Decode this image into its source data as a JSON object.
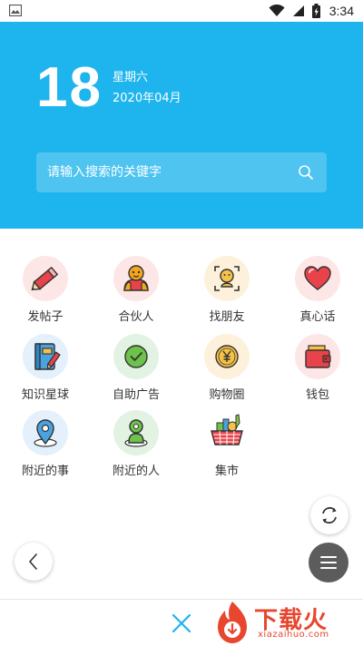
{
  "status_bar": {
    "time": "3:34",
    "icons": [
      "image-icon",
      "wifi-icon",
      "signal-icon",
      "battery-icon"
    ]
  },
  "header": {
    "day": "18",
    "weekday": "星期六",
    "year_month": "2020年04月",
    "background": "#1eb4ee"
  },
  "search": {
    "placeholder": "请输入搜索的关键字",
    "icon": "search-icon"
  },
  "features": [
    {
      "label": "发帖子",
      "icon": "pencil-icon"
    },
    {
      "label": "合伙人",
      "icon": "partner-icon"
    },
    {
      "label": "找朋友",
      "icon": "find-friend-icon"
    },
    {
      "label": "真心话",
      "icon": "heart-icon"
    },
    {
      "label": "知识星球",
      "icon": "notebook-icon"
    },
    {
      "label": "自助广告",
      "icon": "check-circle-icon"
    },
    {
      "label": "购物圈",
      "icon": "yen-coin-icon"
    },
    {
      "label": "钱包",
      "icon": "wallet-icon"
    },
    {
      "label": "附近的事",
      "icon": "location-pin-icon"
    },
    {
      "label": "附近的人",
      "icon": "nearby-person-icon"
    },
    {
      "label": "集市",
      "icon": "basket-icon"
    }
  ],
  "floating": {
    "refresh_icon": "refresh-icon",
    "back_icon": "chevron-left-icon",
    "menu_icon": "hamburger-menu-icon"
  },
  "footer": {
    "close_icon": "close-icon",
    "logo_text": "下载火",
    "logo_domain": "xiazaihuo.com",
    "accent": "#e8462f"
  }
}
